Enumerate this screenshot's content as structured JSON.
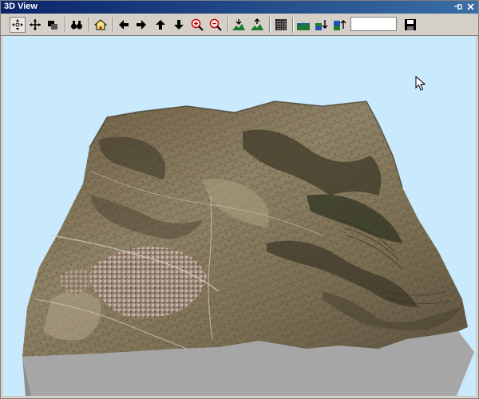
{
  "window": {
    "title": "3D View"
  },
  "titlebar": {
    "pin_icon": "pin-icon",
    "close_icon": "close-icon"
  },
  "toolbar": {
    "tools": [
      "navigate-tool-icon",
      "pan-tool-icon",
      "full-extent-icon",
      "find-icon",
      "home-icon",
      "arrow-left-icon",
      "arrow-right-icon",
      "arrow-up-icon",
      "arrow-down-icon",
      "zoom-in-icon",
      "zoom-out-icon",
      "raise-terrain-icon",
      "lower-terrain-icon",
      "grid-icon",
      "surface-icon",
      "lower-z-icon",
      "raise-z-icon",
      "save-icon"
    ],
    "zoom_value": ""
  },
  "colors": {
    "sky": "#c9e9fc",
    "base": "#a6a6a6",
    "titlebar": "#0a246a",
    "accent_green": "#1d7b2e",
    "accent_blue": "#1f4fbf"
  }
}
